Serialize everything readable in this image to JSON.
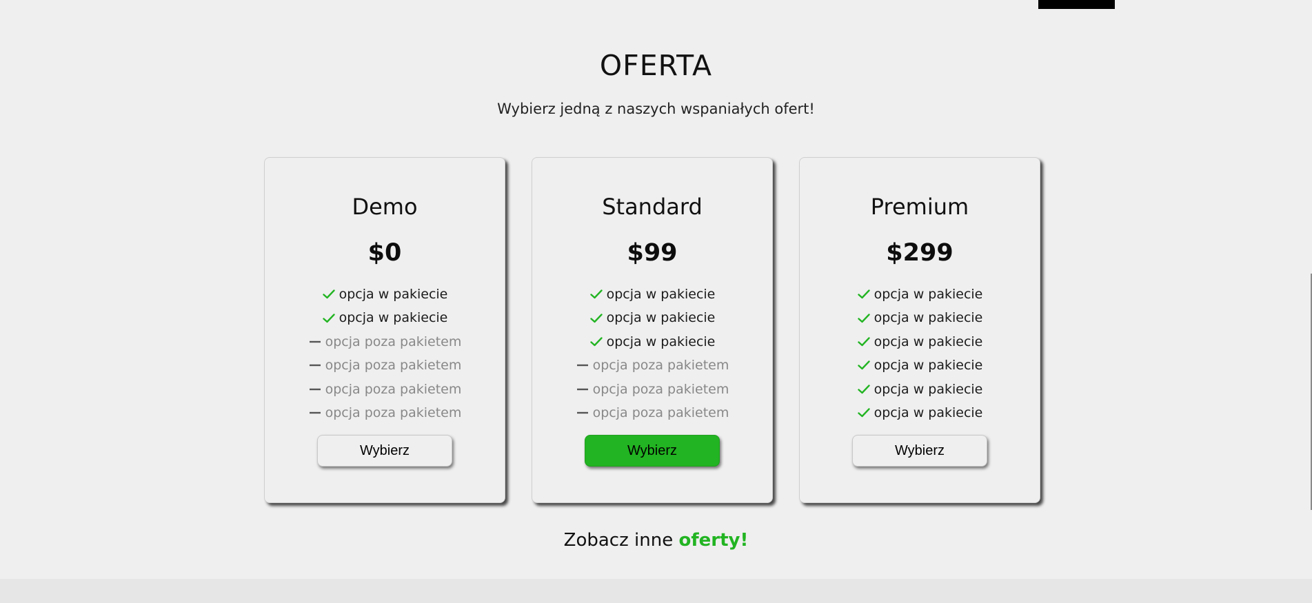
{
  "header": {
    "title": "OFERTA",
    "subtitle": "Wybierz jedną z naszych wspaniałych ofert!"
  },
  "icons": {
    "included": "check-icon",
    "excluded": "dash-icon"
  },
  "colors": {
    "accent": "#22b422",
    "background": "#efefef",
    "excluded_text": "#888888"
  },
  "plans": [
    {
      "name": "Demo",
      "price": "$0",
      "button_label": "Wybierz",
      "features": [
        {
          "text": "opcja w pakiecie",
          "included": true
        },
        {
          "text": "opcja w pakiecie",
          "included": true
        },
        {
          "text": "opcja poza pakietem",
          "included": false
        },
        {
          "text": "opcja poza pakietem",
          "included": false
        },
        {
          "text": "opcja poza pakietem",
          "included": false
        },
        {
          "text": "opcja poza pakietem",
          "included": false
        }
      ]
    },
    {
      "name": "Standard",
      "price": "$99",
      "button_label": "Wybierz",
      "features": [
        {
          "text": "opcja w pakiecie",
          "included": true
        },
        {
          "text": "opcja w pakiecie",
          "included": true
        },
        {
          "text": "opcja w pakiecie",
          "included": true
        },
        {
          "text": "opcja poza pakietem",
          "included": false
        },
        {
          "text": "opcja poza pakietem",
          "included": false
        },
        {
          "text": "opcja poza pakietem",
          "included": false
        }
      ]
    },
    {
      "name": "Premium",
      "price": "$299",
      "button_label": "Wybierz",
      "features": [
        {
          "text": "opcja w pakiecie",
          "included": true
        },
        {
          "text": "opcja w pakiecie",
          "included": true
        },
        {
          "text": "opcja w pakiecie",
          "included": true
        },
        {
          "text": "opcja w pakiecie",
          "included": true
        },
        {
          "text": "opcja w pakiecie",
          "included": true
        },
        {
          "text": "opcja w pakiecie",
          "included": true
        }
      ]
    }
  ],
  "bottom": {
    "text": "Zobacz inne",
    "link_label": "oferty!"
  }
}
